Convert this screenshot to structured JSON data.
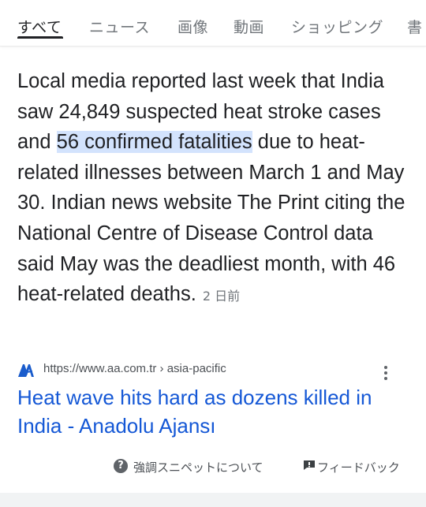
{
  "tabs": [
    {
      "label": "すべて",
      "active": true
    },
    {
      "label": "ニュース"
    },
    {
      "label": "画像"
    },
    {
      "label": "動画"
    },
    {
      "label": "ショッピング"
    },
    {
      "label": "書"
    }
  ],
  "snippet": {
    "before": "Local media reported last week that India saw 24,849 suspected heat stroke cases and ",
    "highlight": "56 confirmed fatalities",
    "after": " due to heat-related illnesses between March 1 and May 30. Indian news website The Print citing the National Centre of Disease Control data said May was the deadliest month, with 46 heat-related deaths.",
    "date": "2 日前"
  },
  "result": {
    "favicon": "anadolu-agency-logo",
    "url": "https://www.aa.com.tr › asia-pacific",
    "title": "Heat wave hits hard as dozens killed in India - Anadolu Ajansı"
  },
  "footer": {
    "about_label": "強調スニペットについて",
    "feedback_label": "フィードバック"
  },
  "colors": {
    "link": "#1558d6",
    "highlight": "#d3e3fd",
    "favicon": "#1a5ccc"
  }
}
